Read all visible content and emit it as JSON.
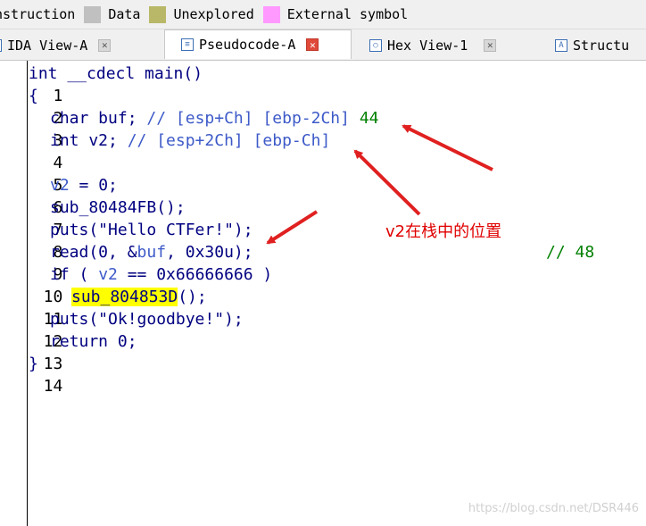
{
  "legend": {
    "items": [
      {
        "label": "nstruction",
        "color": ""
      },
      {
        "label": "Data",
        "color": "#c0c0c0"
      },
      {
        "label": "Unexplored",
        "color": "#b8b868"
      },
      {
        "label": "External symbol",
        "color": "#ff99ff"
      }
    ]
  },
  "tabs": [
    {
      "label": "IDA View-A",
      "icon": "graph-view-icon",
      "active": false
    },
    {
      "label": "Pseudocode-A",
      "icon": "pseudocode-icon",
      "active": true
    },
    {
      "label": "Hex View-1",
      "icon": "hex-view-icon",
      "active": false
    },
    {
      "label": "Structu",
      "icon": "structures-icon",
      "active": false
    }
  ],
  "code": {
    "line_numbers": [
      "1",
      "2",
      "3",
      "4",
      "5",
      "6",
      "7",
      "8",
      "9",
      "10",
      "11",
      "12",
      "13",
      "14"
    ],
    "l1": "int __cdecl main()",
    "l2": "{",
    "l3_decl": "char buf;",
    "l3_comment": "// [esp+Ch] [ebp-2Ch]",
    "l3_num": "44",
    "l4_decl": "int v2;",
    "l4_comment": "// [esp+2Ch] [ebp-Ch]",
    "l6_var": "v2",
    "l6_rest": " = 0;",
    "l7": "sub_80484FB();",
    "l8": "puts(\"Hello CTFer!\");",
    "l9_a": "read(0, &",
    "l9_var": "buf",
    "l9_b": ", 0x30u);",
    "l9_comment": "// 48",
    "l10_a": "if ( ",
    "l10_var": "v2",
    "l10_b": " == 0x66666666 )",
    "l11_hl": "sub_804853D",
    "l11_rest": "();",
    "l12": "puts(\"Ok!goodbye!\");",
    "l13": "return 0;",
    "l14": "}"
  },
  "annotation": "v2在栈中的位置",
  "arrow_color": "#e02020",
  "watermark": "https://blog.csdn.net/DSR446"
}
